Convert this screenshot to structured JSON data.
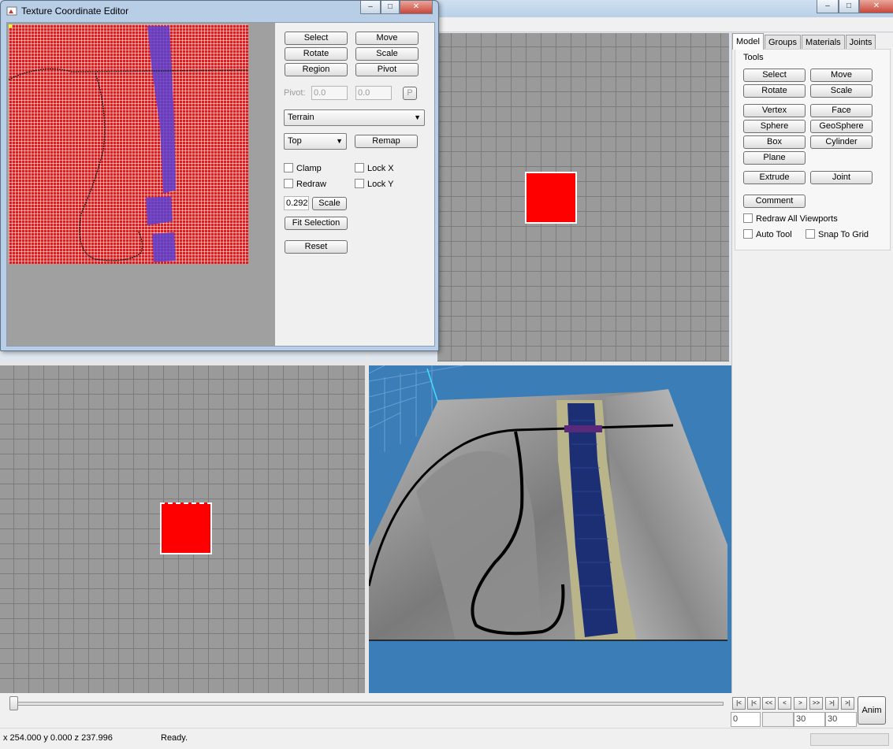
{
  "texture_editor": {
    "title": "Texture Coordinate Editor",
    "buttons": {
      "select": "Select",
      "move": "Move",
      "rotate": "Rotate",
      "scale": "Scale",
      "region": "Region",
      "pivot": "Pivot",
      "remap": "Remap",
      "scale_apply": "Scale",
      "fit_selection": "Fit Selection",
      "reset": "Reset",
      "pivot_p": "P"
    },
    "pivot_label": "Pivot:",
    "pivot_x": "0.0",
    "pivot_y": "0.0",
    "material_select": "Terrain",
    "projection_select": "Top",
    "checkboxes": {
      "clamp": "Clamp",
      "lock_x": "Lock X",
      "redraw": "Redraw",
      "lock_y": "Lock Y"
    },
    "scale_value": "0.292"
  },
  "right_panel": {
    "tabs": [
      "Model",
      "Groups",
      "Materials",
      "Joints"
    ],
    "group_label": "Tools",
    "tools": {
      "select": "Select",
      "move": "Move",
      "rotate": "Rotate",
      "scale": "Scale",
      "vertex": "Vertex",
      "face": "Face",
      "sphere": "Sphere",
      "geosphere": "GeoSphere",
      "box": "Box",
      "cylinder": "Cylinder",
      "plane": "Plane",
      "extrude": "Extrude",
      "joint": "Joint",
      "comment": "Comment"
    },
    "options": {
      "redraw_all": "Redraw All Viewports",
      "auto_tool": "Auto Tool",
      "snap_to_grid": "Snap To Grid"
    }
  },
  "timeline": {
    "frame_current": "0",
    "frame_start": "30",
    "frame_end": "30",
    "nav": [
      "|<",
      "|<",
      "<<",
      "<",
      ">",
      ">>",
      ">|",
      ">|"
    ],
    "anim_label": "Anim"
  },
  "status": {
    "coords": "x 254.000 y 0.000 z 237.996",
    "text": "Ready."
  },
  "window_controls": {
    "minimize": "–",
    "maximize": "□",
    "close": "✕"
  },
  "colors": {
    "selection_red": "#ff0000",
    "viewport_grey": "#9a9a9a",
    "viewport_3d_bg": "#3b7db6"
  }
}
